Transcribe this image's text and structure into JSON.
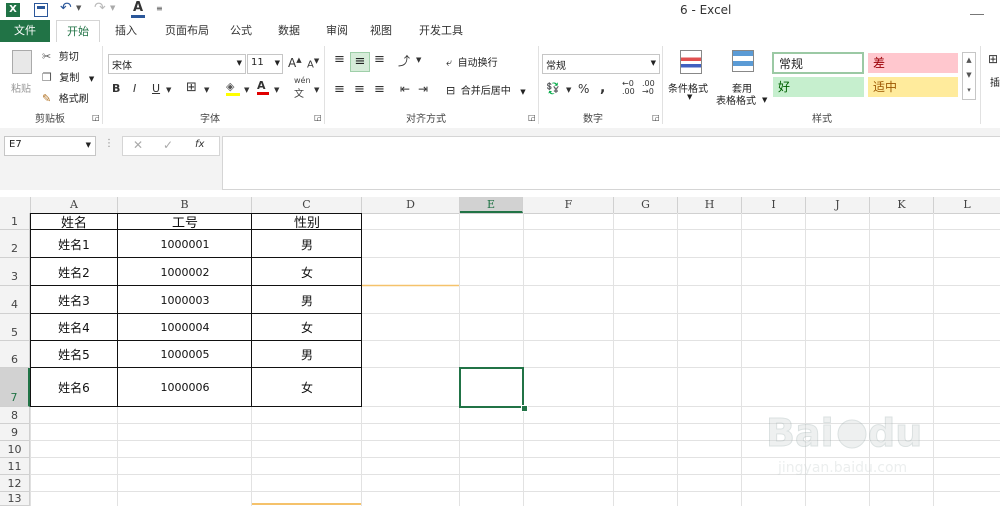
{
  "window": {
    "title": "6 - Excel"
  },
  "quick_access": {
    "undo_icon": "↶",
    "redo_icon": "↷",
    "font_color_letter": "A"
  },
  "tabs": [
    {
      "label": "文件"
    },
    {
      "label": "开始"
    },
    {
      "label": "插入"
    },
    {
      "label": "页面布局"
    },
    {
      "label": "公式"
    },
    {
      "label": "数据"
    },
    {
      "label": "审阅"
    },
    {
      "label": "视图"
    },
    {
      "label": "开发工具"
    }
  ],
  "ribbon": {
    "clipboard": {
      "paste": "粘贴",
      "cut": "剪切",
      "copy": "复制",
      "format_painter": "格式刷",
      "label": "剪贴板"
    },
    "font": {
      "name": "宋体",
      "size": "11",
      "bold": "B",
      "italic": "I",
      "underline": "U",
      "label": "字体",
      "phonetic": "wén"
    },
    "alignment": {
      "wrap": "自动换行",
      "merge": "合并后居中",
      "label": "对齐方式"
    },
    "number": {
      "format": "常规",
      "percent": "%",
      "comma": ",",
      "label": "数字"
    },
    "styles": {
      "conditional": "条件格式",
      "table_format_1": "套用",
      "table_format_2": "表格格式",
      "normal": "常规",
      "bad": "差",
      "good": "好",
      "neutral": "适中",
      "label": "样式"
    },
    "insert_partial": "插"
  },
  "formula_bar": {
    "name_box": "E7",
    "fx": "fx",
    "value": ""
  },
  "columns": [
    "A",
    "B",
    "C",
    "D",
    "E",
    "F",
    "G",
    "H",
    "I",
    "J",
    "K",
    "L"
  ],
  "rows": [
    "1",
    "2",
    "3",
    "4",
    "5",
    "6",
    "7",
    "8",
    "9",
    "10",
    "11",
    "12",
    "13"
  ],
  "table": {
    "headers": [
      "姓名",
      "工号",
      "性别"
    ],
    "rows": [
      [
        "姓名1",
        "1000001",
        "男"
      ],
      [
        "姓名2",
        "1000002",
        "女"
      ],
      [
        "姓名3",
        "1000003",
        "男"
      ],
      [
        "姓名4",
        "1000004",
        "女"
      ],
      [
        "姓名5",
        "1000005",
        "男"
      ],
      [
        "姓名6",
        "1000006",
        "女"
      ]
    ]
  },
  "selected_cell": "E7",
  "colors": {
    "excel_green": "#217346",
    "bad_bg": "#ffc7ce",
    "good_bg": "#c6efce",
    "neutral_bg": "#ffeb9c"
  }
}
